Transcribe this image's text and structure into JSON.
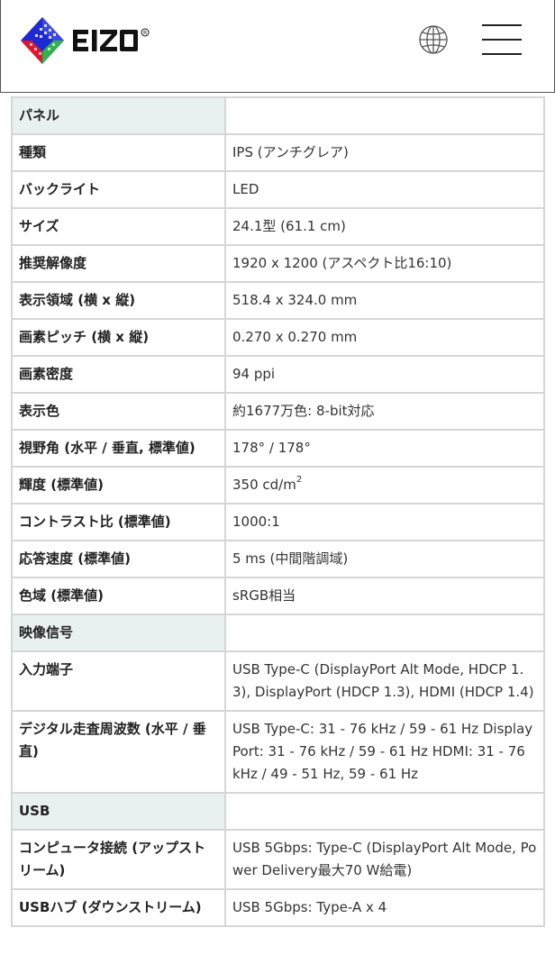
{
  "header": {
    "logo_text": "EIZO",
    "registered_mark": "®",
    "globe_icon": "globe-icon",
    "menu_icon": "hamburger-menu-icon"
  },
  "spec_rows": [
    {
      "label": "パネル",
      "value": "",
      "section": true
    },
    {
      "label": "種類",
      "value": "IPS (アンチグレア)"
    },
    {
      "label": "バックライト",
      "value": "LED"
    },
    {
      "label": "サイズ",
      "value": "24.1型 (61.1 cm)"
    },
    {
      "label": "推奨解像度",
      "value": "1920 x 1200 (アスペクト比16:10)"
    },
    {
      "label": "表示領域 (横 x 縦)",
      "value": "518.4 x 324.0 mm"
    },
    {
      "label": "画素ピッチ (横 x 縦)",
      "value": "0.270 x 0.270 mm"
    },
    {
      "label": "画素密度",
      "value": "94 ppi"
    },
    {
      "label": "表示色",
      "value": "約1677万色: 8-bit対応"
    },
    {
      "label": "視野角 (水平 / 垂直, 標準値)",
      "value": "178° / 178°"
    },
    {
      "label": "輝度 (標準値)",
      "value": "350 cd/m",
      "sup": "2"
    },
    {
      "label": "コントラスト比 (標準値)",
      "value": "1000:1"
    },
    {
      "label": "応答速度 (標準値)",
      "value": "5 ms (中間階調域)"
    },
    {
      "label": "色域 (標準値)",
      "value": "sRGB相当"
    },
    {
      "label": "映像信号",
      "value": "",
      "section": true
    },
    {
      "label": "入力端子",
      "value": "USB Type-C (DisplayPort Alt Mode, HDCP 1.3), DisplayPort (HDCP 1.3), HDMI (HDCP 1.4)"
    },
    {
      "label": "デジタル走査周波数 (水平 / 垂直)",
      "value": "USB Type-C: 31 - 76 kHz / 59 - 61 Hz DisplayPort: 31 - 76 kHz / 59 - 61 Hz HDMI: 31 - 76 kHz / 49 - 51 Hz, 59 - 61 Hz"
    },
    {
      "label": "USB",
      "value": "",
      "section": true
    },
    {
      "label": "コンピュータ接続 (アップストリーム)",
      "value": "USB 5Gbps: Type-C (DisplayPort Alt Mode, Power Delivery最大70 W給電)"
    },
    {
      "label": "USBハブ (ダウンストリーム)",
      "value": "USB 5Gbps: Type-A x 4"
    }
  ]
}
